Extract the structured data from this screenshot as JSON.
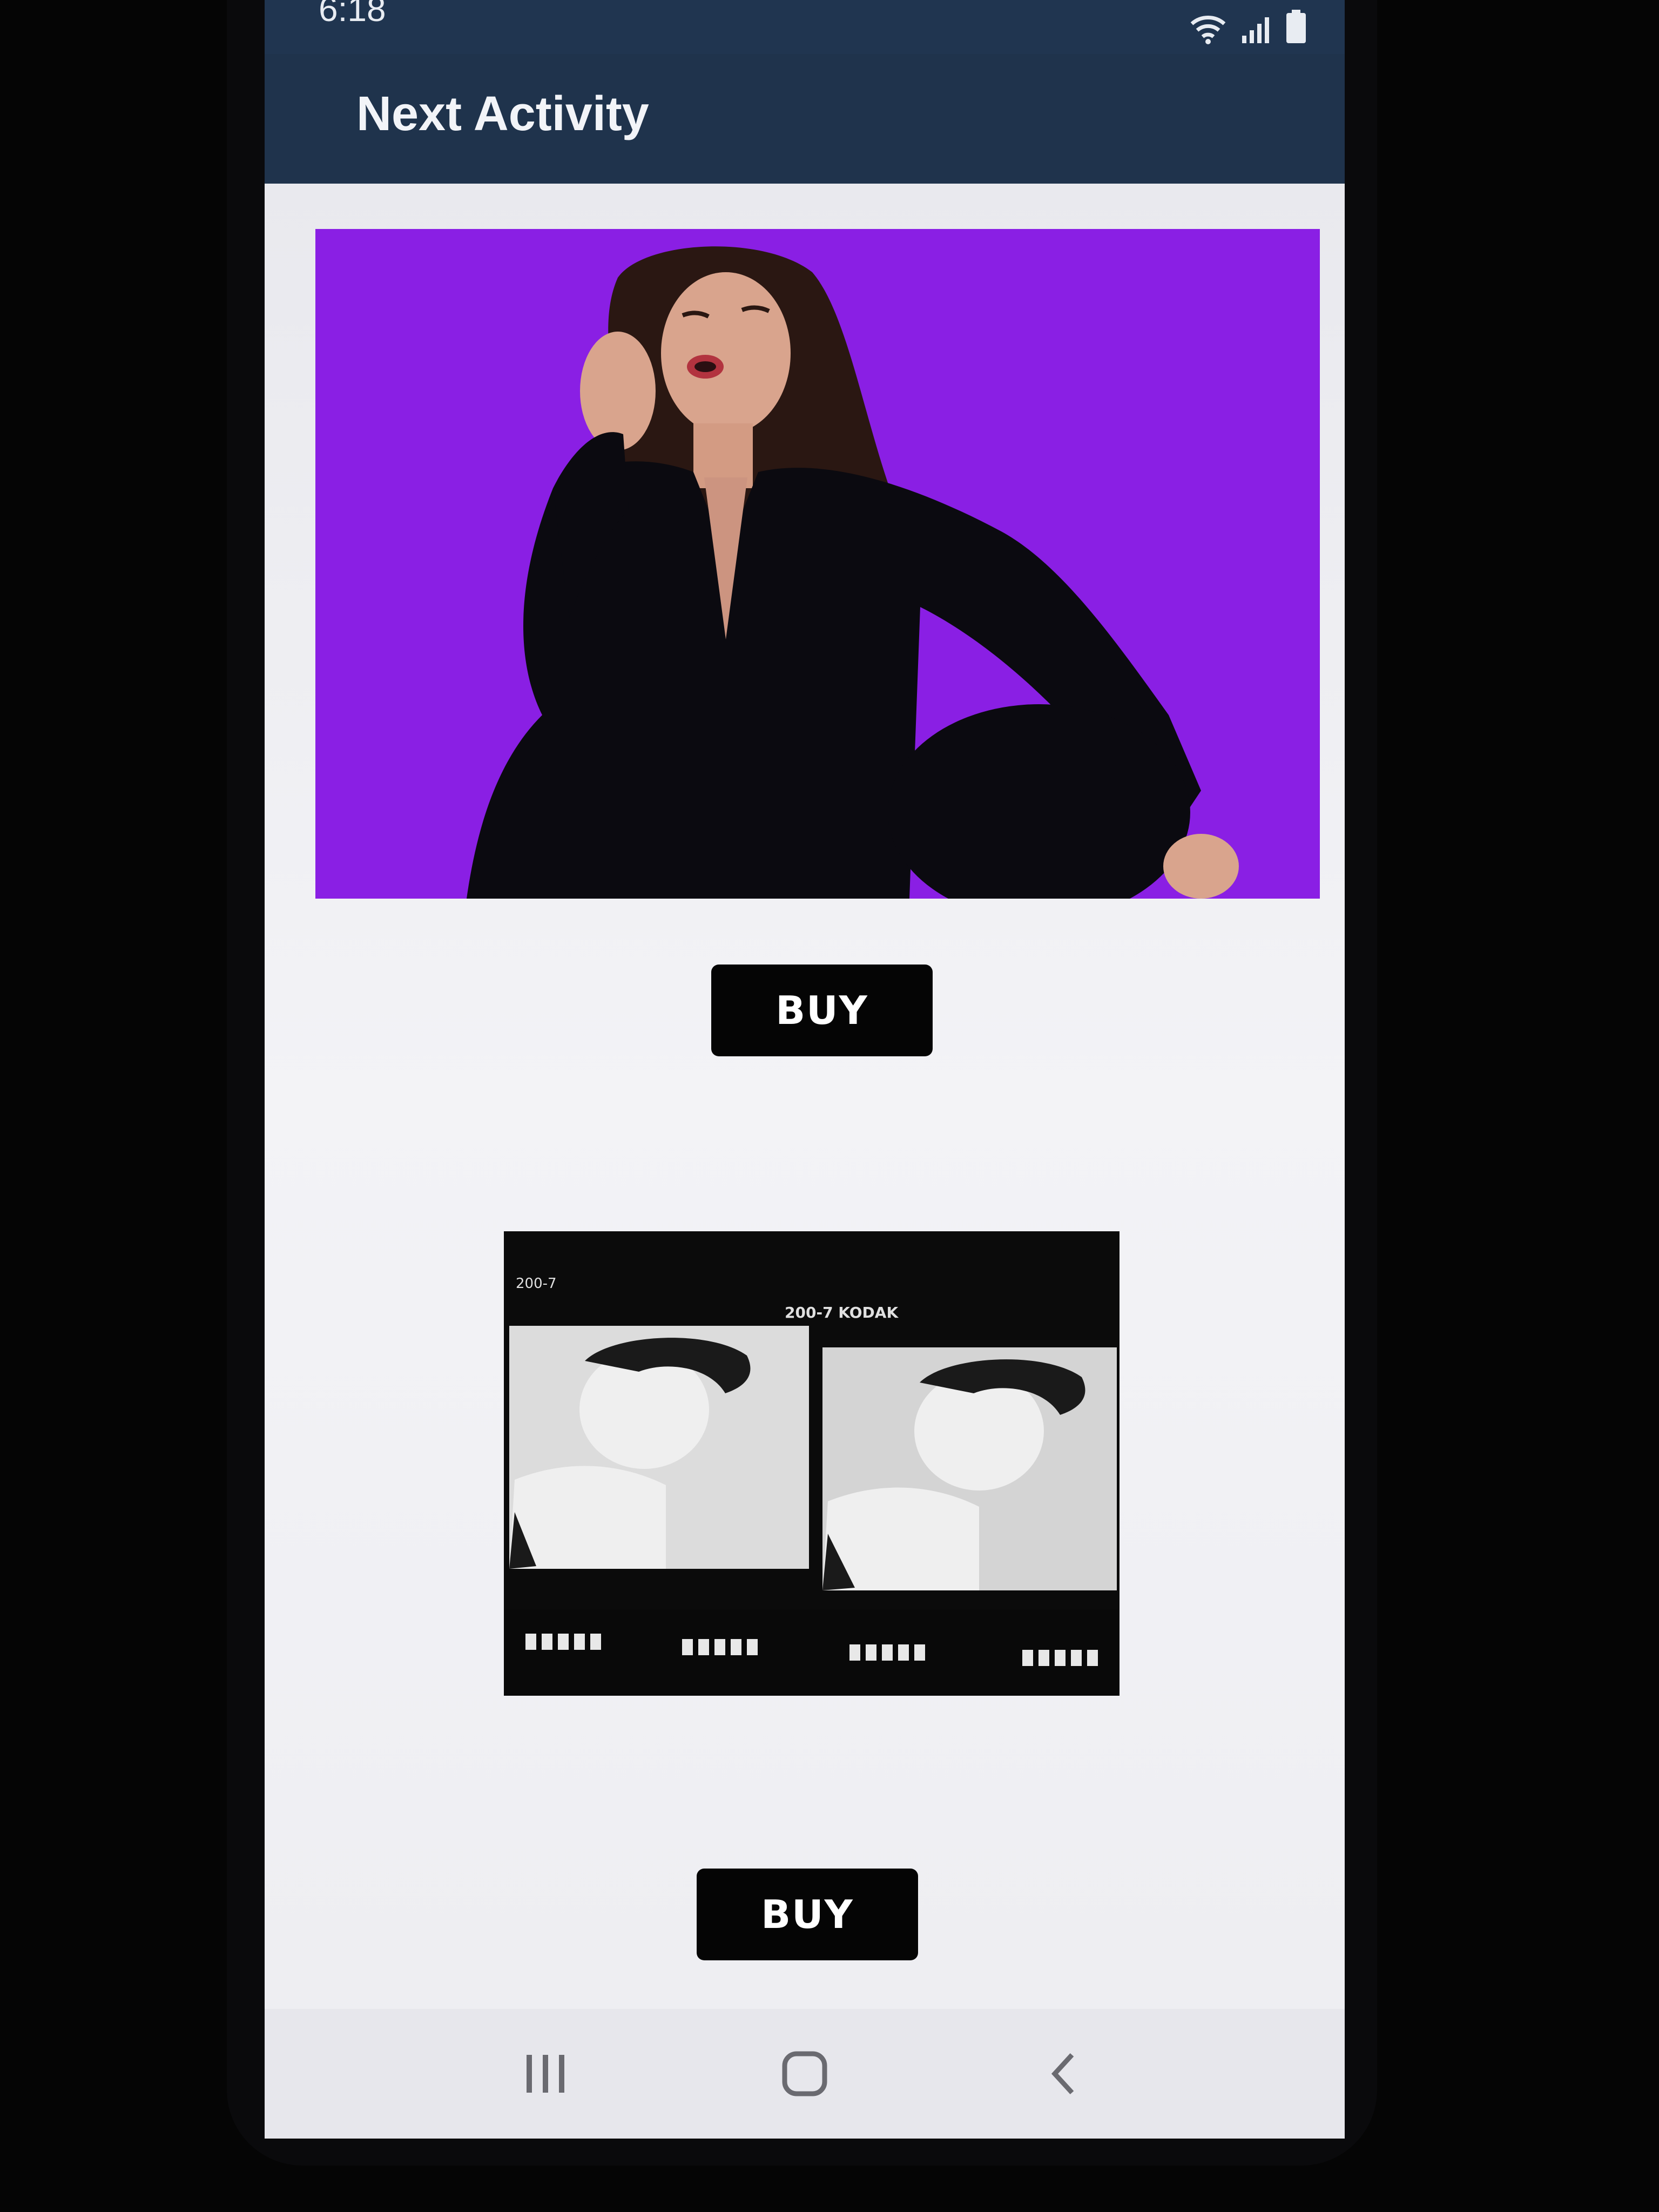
{
  "status_bar": {
    "time": "6:18",
    "icons": [
      "wifi-icon",
      "signal-icon",
      "battery-icon"
    ]
  },
  "app_bar": {
    "title": "Next Activity",
    "color": "#1f334c"
  },
  "products": [
    {
      "image": "portrait-purple-background",
      "background_color": "#8a1fe4",
      "button_label": "BUY"
    },
    {
      "image": "film-strip-photo",
      "film_text_top_left": "200-7",
      "film_text_top": "200-7 KODAK",
      "button_label": "BUY"
    }
  ],
  "nav_bar": {
    "items": [
      "recent-apps-icon",
      "home-icon",
      "back-icon"
    ]
  }
}
